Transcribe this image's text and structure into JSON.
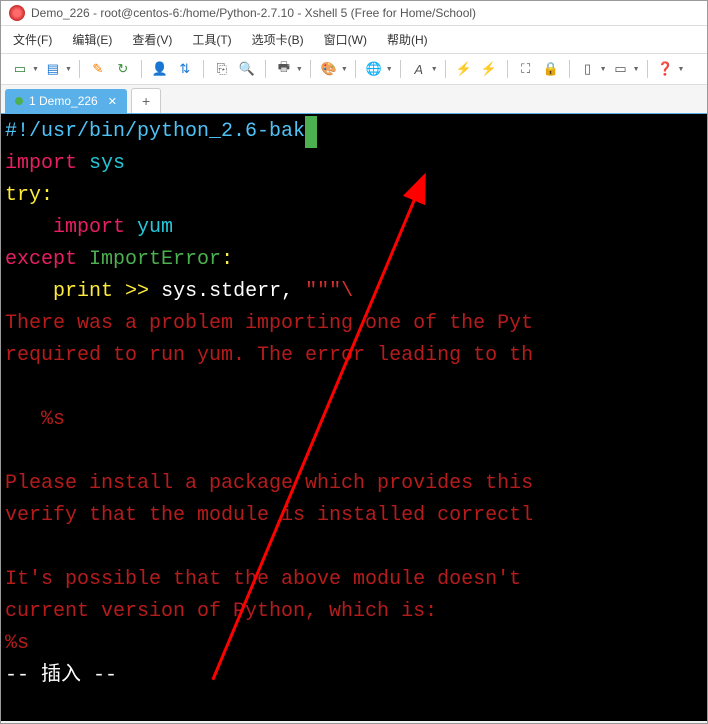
{
  "window": {
    "title": "Demo_226 - root@centos-6:/home/Python-2.7.10 - Xshell 5 (Free for Home/School)"
  },
  "menu": {
    "file": "文件(F)",
    "edit": "编辑(E)",
    "view": "查看(V)",
    "tools": "工具(T)",
    "tabs": "选项卡(B)",
    "window": "窗口(W)",
    "help": "帮助(H)"
  },
  "tab": {
    "label": "1 Demo_226",
    "add": "+"
  },
  "code": {
    "shebang": "#!/usr/bin/python_2.6-bak",
    "import_kw": "import",
    "sys": "sys",
    "try_kw": "try",
    "colon": ":",
    "yum": "yum",
    "except_kw": "except",
    "import_error": "ImportError",
    "print_kw": "print",
    "arrow": ">>",
    "stderr": "sys.stderr",
    "comma": ",",
    "triple_quote": "\"\"\"\\",
    "err_l1": "There was a problem importing one of the Pyt",
    "err_l2": "required to run yum. The error leading to th",
    "err_l3": "   %s",
    "err_l4": "Please install a package which provides this",
    "err_l5": "verify that the module is installed correctl",
    "err_l6": "It's possible that the above module doesn't ",
    "err_l7": "current version of Python, which is:",
    "err_l8": "%s",
    "status": "-- 插入 --"
  }
}
